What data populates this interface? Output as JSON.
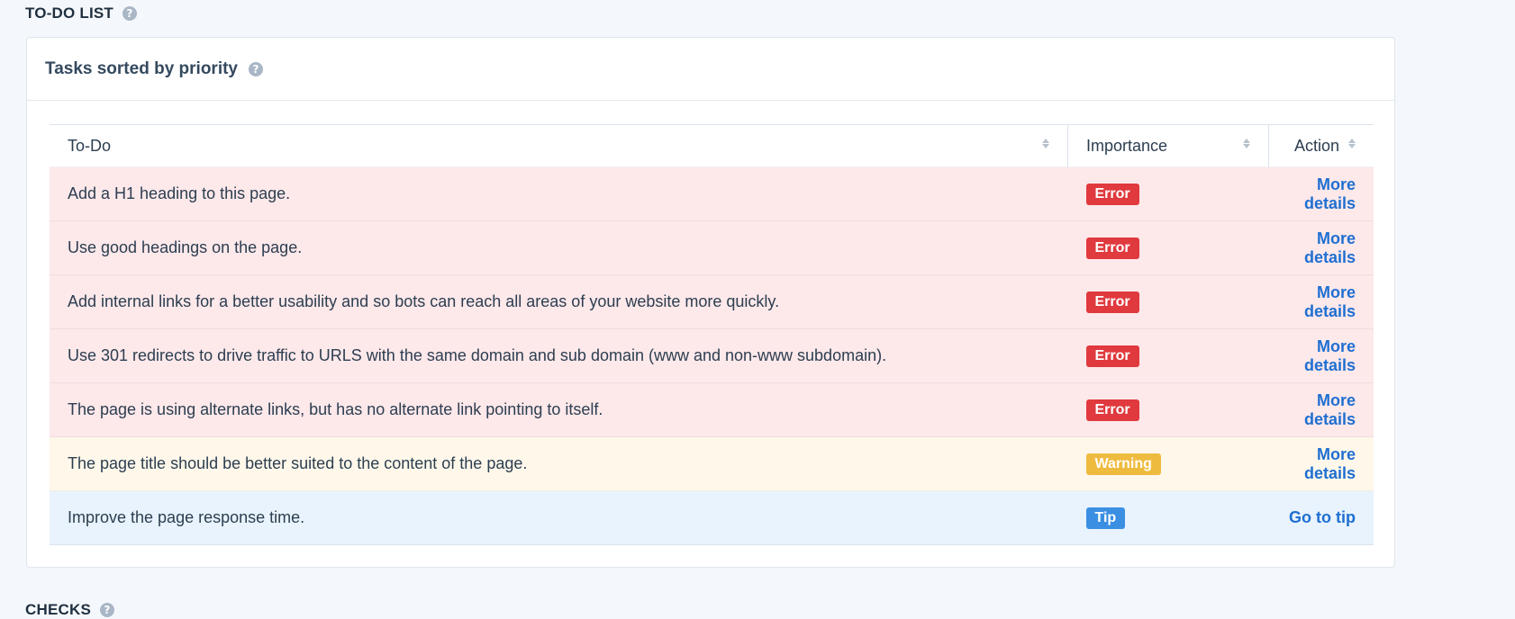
{
  "todo_section": {
    "title": "TO-DO LIST",
    "help": "?"
  },
  "card": {
    "title": "Tasks sorted by priority",
    "help": "?"
  },
  "table": {
    "headers": {
      "todo": "To-Do",
      "importance": "Importance",
      "action": "Action"
    },
    "rows": [
      {
        "task": "Add a H1 heading to this page.",
        "importance": "Error",
        "action": "More details",
        "type": "error"
      },
      {
        "task": "Use good headings on the page.",
        "importance": "Error",
        "action": "More details",
        "type": "error"
      },
      {
        "task": "Add internal links for a better usability and so bots can reach all areas of your website more quickly.",
        "importance": "Error",
        "action": "More details",
        "type": "error"
      },
      {
        "task": "Use 301 redirects to drive traffic to URLS with the same domain and sub domain (www and non-www subdomain).",
        "importance": "Error",
        "action": "More details",
        "type": "error"
      },
      {
        "task": "The page is using alternate links, but has no alternate link pointing to itself.",
        "importance": "Error",
        "action": "More details",
        "type": "error"
      },
      {
        "task": "The page title should be better suited to the content of the page.",
        "importance": "Warning",
        "action": "More details",
        "type": "warning"
      },
      {
        "task": "Improve the page response time.",
        "importance": "Tip",
        "action": "Go to tip",
        "type": "tip"
      }
    ]
  },
  "checks_section": {
    "title": "CHECKS",
    "help": "?"
  },
  "colors": {
    "error": "#e0393e",
    "warning": "#efbb3f",
    "tip": "#3b8fe3",
    "link": "#1f6fd1"
  }
}
